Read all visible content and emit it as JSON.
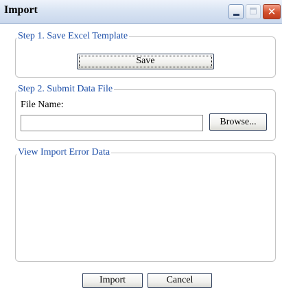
{
  "window": {
    "title": "Import",
    "controls": {
      "minimize_icon": "minimize-icon",
      "maximize_icon": "maximize-icon",
      "close_icon": "close-icon",
      "close_glyph": "✕"
    }
  },
  "step1": {
    "legend": "Step 1. Save Excel Template",
    "save_label": "Save"
  },
  "step2": {
    "legend": "Step 2. Submit Data File",
    "file_label": "File Name:",
    "file_value": "",
    "browse_label": "Browse..."
  },
  "errors": {
    "legend": "View Import Error Data",
    "content": ""
  },
  "footer": {
    "import_label": "Import",
    "cancel_label": "Cancel"
  },
  "colors": {
    "legend_text": "#1c4ea8",
    "titlebar": "#d9e4f3",
    "close_button": "#d4512e"
  }
}
